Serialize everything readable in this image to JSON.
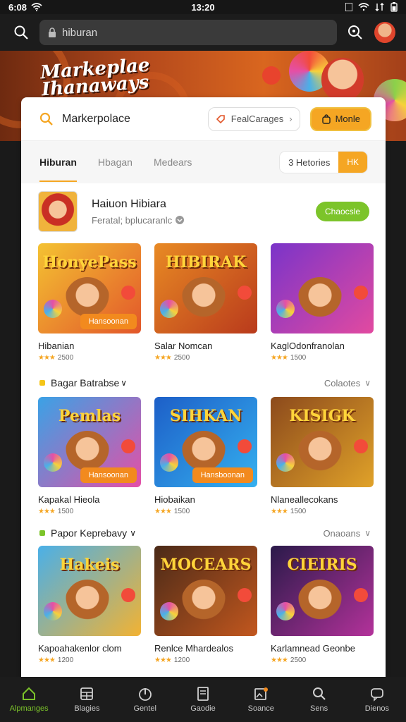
{
  "status": {
    "left_time": "6:08",
    "center_time": "13:20"
  },
  "browser": {
    "url": "hiburan"
  },
  "hero": {
    "line1": "Markeplae",
    "line2": "Ihanaways"
  },
  "search": {
    "text": "Markerpolace",
    "category_label": "FealCarages",
    "primary_label": "Monle"
  },
  "tabs": {
    "items": [
      "Hiburan",
      "Hbagan",
      "Medears"
    ],
    "sort_label": "3 Hetories",
    "sort_button": "HK"
  },
  "featured": {
    "title": "Haiuon Hibiara",
    "subtitle": "Feratal; bplucaranlc",
    "button": "Chaocsle"
  },
  "sections": [
    {
      "title": null,
      "more": null,
      "tiles": [
        {
          "name": "Hibanian",
          "meta": "2500",
          "thumb_title": "HonyePass",
          "badge": "Hansoonan",
          "colors": [
            "#f4c232",
            "#e2562a"
          ]
        },
        {
          "name": "Salar Nomcan",
          "meta": "2500",
          "thumb_title": "HIBIRAK",
          "badge": "",
          "colors": [
            "#e88a24",
            "#b93a1c"
          ]
        },
        {
          "name": "KaglOdonfranolan",
          "meta": "1500",
          "thumb_title": "",
          "badge": "",
          "colors": [
            "#7a34c9",
            "#e24aa0"
          ]
        }
      ]
    },
    {
      "title": "Bagar Batrabse",
      "more": "Colaotes",
      "tiles": [
        {
          "name": "Kapakal Hieola",
          "meta": "1500",
          "thumb_title": "Pemlas",
          "badge": "Hansoonan",
          "colors": [
            "#3aa2e6",
            "#e54fa6"
          ]
        },
        {
          "name": "Hiobaikan",
          "meta": "1500",
          "thumb_title": "SIHKAN",
          "badge": "Hansboonan",
          "colors": [
            "#1d5fc8",
            "#35b0ef"
          ]
        },
        {
          "name": "Nlaneallecokans",
          "meta": "1500",
          "thumb_title": "KISIGK",
          "badge": "",
          "colors": [
            "#8c4a1c",
            "#e0a229"
          ]
        }
      ]
    },
    {
      "title": "Papor Keprebavy",
      "more": "Onaoans",
      "tiles": [
        {
          "name": "Kapoahakenlor clom",
          "meta": "1200",
          "thumb_title": "Hakeis",
          "badge": "",
          "colors": [
            "#4ab0e8",
            "#f2b233"
          ]
        },
        {
          "name": "Renlce Mhardealos",
          "meta": "1200",
          "thumb_title": "MOCEARS",
          "badge": "",
          "colors": [
            "#4a2a18",
            "#c2571e"
          ]
        },
        {
          "name": "Karlamnead Geonbe",
          "meta": "2500",
          "thumb_title": "CIEIRIS",
          "badge": "",
          "colors": [
            "#2a1a4a",
            "#b3329a"
          ]
        }
      ]
    }
  ],
  "nav": [
    {
      "label": "Alpmanges",
      "icon": "home-icon",
      "active": true
    },
    {
      "label": "Blagies",
      "icon": "grid-icon",
      "active": false
    },
    {
      "label": "Gentel",
      "icon": "power-icon",
      "active": false
    },
    {
      "label": "Gaodie",
      "icon": "page-icon",
      "active": false
    },
    {
      "label": "Soance",
      "icon": "image-icon",
      "active": false
    },
    {
      "label": "Sens",
      "icon": "search-icon",
      "active": false
    },
    {
      "label": "Dienos",
      "icon": "chat-icon",
      "active": false
    }
  ],
  "accent": "#f5a623",
  "green": "#7cc42a"
}
